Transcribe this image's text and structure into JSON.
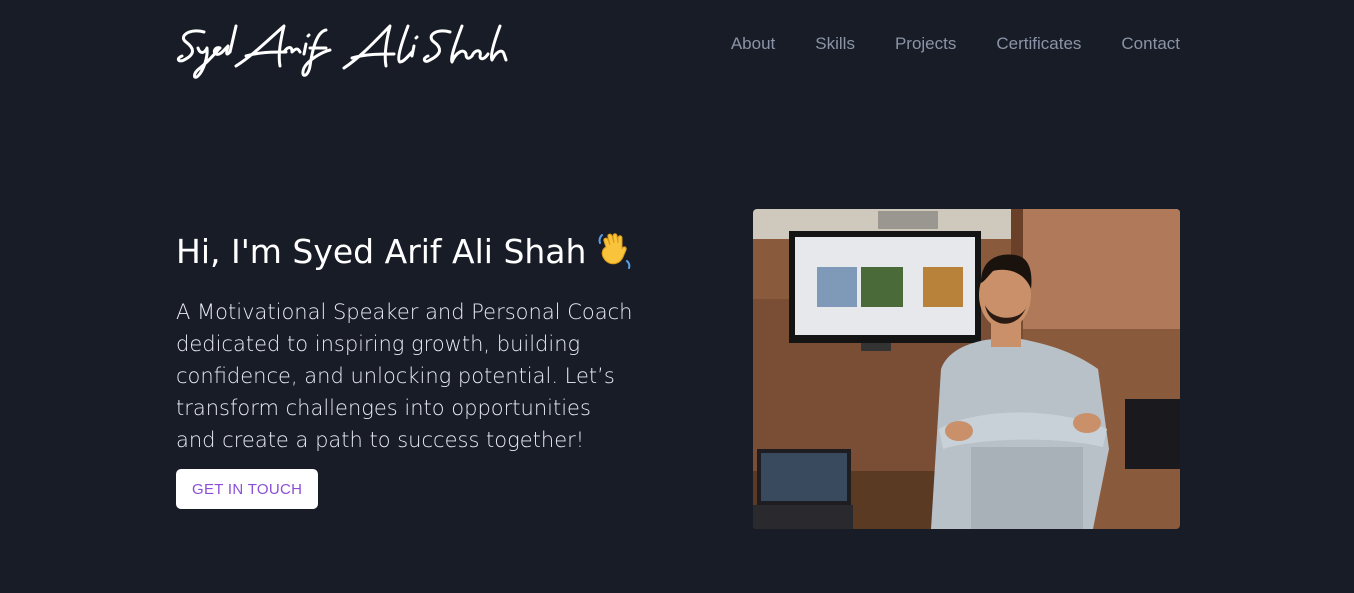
{
  "header": {
    "logo_text": "Syed Arif Ali Shah",
    "nav": [
      "About",
      "Skills",
      "Projects",
      "Certificates",
      "Contact"
    ]
  },
  "hero": {
    "title": "Hi, I'm Syed Arif Ali Shah",
    "wave_icon": "waving-hand-icon",
    "description": "A Motivational Speaker and Personal Coach dedicated to inspiring growth, building confidence, and unlocking potential. Let’s transform challenges into opportunities and create a path to success together!",
    "cta_label": "GET IN TOUCH"
  },
  "colors": {
    "background": "#181c27",
    "nav_link": "#8a94a6",
    "cta_text": "#8b4fd6",
    "cta_bg": "#ffffff"
  }
}
